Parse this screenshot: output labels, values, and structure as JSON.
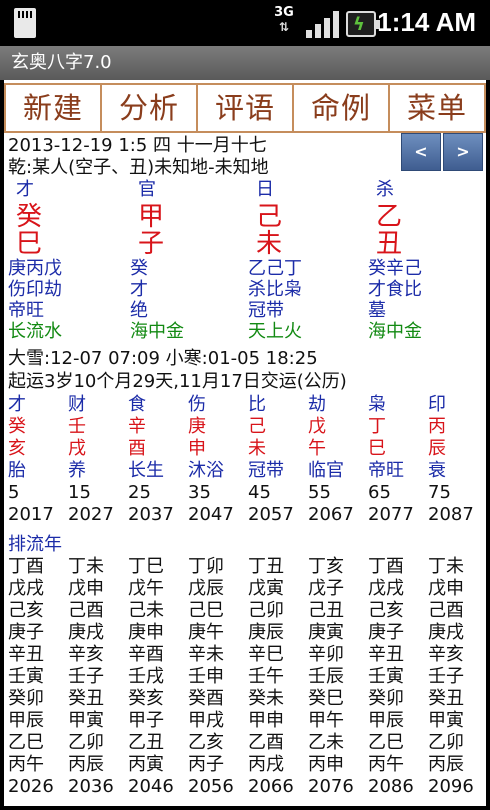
{
  "status_bar": {
    "network": "3G",
    "time": "1:14 AM"
  },
  "app_title": "玄奥八字7.0",
  "toolbar": [
    "新建",
    "分析",
    "评语",
    "命例",
    "菜单"
  ],
  "nav": {
    "prev": "<",
    "next": ">"
  },
  "header": {
    "line1": "2013-12-19 1:5  四  十一月十七",
    "line2": "乾:某人(空子、丑)未知地-未知地"
  },
  "pillars": [
    {
      "shishen": "才",
      "stem": "癸",
      "branch": "巳",
      "hidden1": "庚丙戊",
      "hidden2": "伤印劫",
      "stage": "帝旺",
      "nayin": "长流水"
    },
    {
      "shishen": "官",
      "stem": "甲",
      "branch": "子",
      "hidden1": "癸",
      "hidden2": "才",
      "stage": "绝",
      "nayin": "海中金"
    },
    {
      "shishen": "日",
      "stem": "己",
      "branch": "未",
      "hidden1": "乙己丁",
      "hidden2": "杀比枭",
      "stage": "冠带",
      "nayin": "天上火"
    },
    {
      "shishen": "杀",
      "stem": "乙",
      "branch": "丑",
      "hidden1": "癸辛己",
      "hidden2": "才食比",
      "stage": "墓",
      "nayin": "海中金"
    }
  ],
  "jieqi": "大雪:12-07 07:09  小寒:01-05 18:25",
  "qiyun": "起运3岁10个月29天,11月17日交运(公历)",
  "dayun": {
    "shishen": [
      "才",
      "财",
      "食",
      "伤",
      "比",
      "劫",
      "枭",
      "印"
    ],
    "stems": [
      "癸",
      "壬",
      "辛",
      "庚",
      "己",
      "戊",
      "丁",
      "丙"
    ],
    "branches": [
      "亥",
      "戌",
      "酉",
      "申",
      "未",
      "午",
      "巳",
      "辰"
    ],
    "stages": [
      "胎",
      "养",
      "长生",
      "沐浴",
      "冠带",
      "临官",
      "帝旺",
      "衰"
    ],
    "ages": [
      "5",
      "15",
      "25",
      "35",
      "45",
      "55",
      "65",
      "75"
    ],
    "years": [
      "2017",
      "2027",
      "2037",
      "2047",
      "2057",
      "2067",
      "2077",
      "2087"
    ]
  },
  "liunian_label": "排流年",
  "liunian": [
    [
      "丁酉",
      "丁未",
      "丁巳",
      "丁卯",
      "丁丑",
      "丁亥",
      "丁酉",
      "丁未"
    ],
    [
      "戊戌",
      "戊申",
      "戊午",
      "戊辰",
      "戊寅",
      "戊子",
      "戊戌",
      "戊申"
    ],
    [
      "己亥",
      "己酉",
      "己未",
      "己巳",
      "己卯",
      "己丑",
      "己亥",
      "己酉"
    ],
    [
      "庚子",
      "庚戌",
      "庚申",
      "庚午",
      "庚辰",
      "庚寅",
      "庚子",
      "庚戌"
    ],
    [
      "辛丑",
      "辛亥",
      "辛酉",
      "辛未",
      "辛巳",
      "辛卯",
      "辛丑",
      "辛亥"
    ],
    [
      "壬寅",
      "壬子",
      "壬戌",
      "壬申",
      "壬午",
      "壬辰",
      "壬寅",
      "壬子"
    ],
    [
      "癸卯",
      "癸丑",
      "癸亥",
      "癸酉",
      "癸未",
      "癸巳",
      "癸卯",
      "癸丑"
    ],
    [
      "甲辰",
      "甲寅",
      "甲子",
      "甲戌",
      "甲申",
      "甲午",
      "甲辰",
      "甲寅"
    ],
    [
      "乙巳",
      "乙卯",
      "乙丑",
      "乙亥",
      "乙酉",
      "乙未",
      "乙巳",
      "乙卯"
    ],
    [
      "丙午",
      "丙辰",
      "丙寅",
      "丙子",
      "丙戌",
      "丙申",
      "丙午",
      "丙辰"
    ],
    [
      "2026",
      "2036",
      "2046",
      "2056",
      "2066",
      "2076",
      "2086",
      "2096"
    ]
  ]
}
